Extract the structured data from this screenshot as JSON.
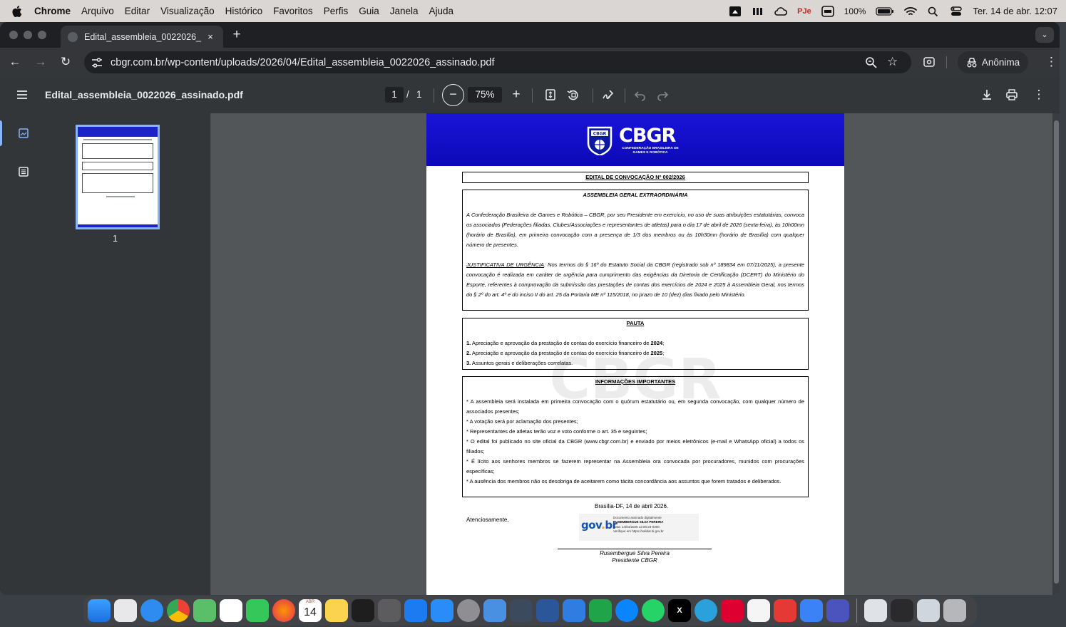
{
  "menubar": {
    "app_name": "Chrome",
    "menus": [
      "Arquivo",
      "Editar",
      "Visualização",
      "Histórico",
      "Favoritos",
      "Perfis",
      "Guia",
      "Janela",
      "Ajuda"
    ],
    "pje_label": "PJe",
    "battery": "100%",
    "clock": "Ter. 14 de abr.  12:07"
  },
  "browser": {
    "tab_title": "Edital_assembleia_0022026_",
    "tab_close": "×",
    "new_tab": "+",
    "url": "cbgr.com.br/wp-content/uploads/2026/04/Edital_assembleia_0022026_assinado.pdf",
    "incognito_label": "Anônima"
  },
  "pdf": {
    "file_name": "Edital_assembleia_0022026_assinado.pdf",
    "current_page": "1",
    "page_separator": "/",
    "total_pages": "1",
    "zoom": "75%",
    "thumbnail_label": "1"
  },
  "document": {
    "logo_text": "CBGR",
    "logo_subtitle": "CONFEDERAÇÃO BRASILEIRA DE GAMES E ROBÓTICA",
    "edital_title": "EDITAL DE CONVOCAÇÃO Nº 002/2026",
    "assembly_title": "ASSEMBLEIA GERAL EXTRAORDINÁRIA",
    "convocation_paragraph": "A Confederação Brasileira de Games e Robótica – CBGR, por seu Presidente em exercício, no uso de suas atribuições estatutárias, convoca os associados (Federações filiadas, Clubes/Associações e representantes de atletas) para o dia 17 de abril de 2026 (sexta-feira), às 10h00mn (horário de Brasília), em primeira convocação com a presença de 1/3 dos membros ou às 10h30mn (horário de Brasília) com qualquer número de presentes.",
    "urgency_label": "JUSTIFICATIVA DE URGÊNCIA",
    "urgency_text": ": Nos termos do § 16º do Estatuto Social da CBGR (registrado sob nº 189834 em 07/11/2025), a presente convocação é realizada em caráter de urgência para cumprimento das exigências da Diretoria de Certificação (DCERT) do Ministério do Esporte, referentes à comprovação da submissão das prestações de contas dos exercícios de 2024 e 2025 à Assembleia Geral, nos termos do § 2º do art. 4º e do inciso II do art. 25 da Portaria ME nº 115/2018, no prazo de 10 (dez) dias fixado pelo Ministério.",
    "pauta_title": "PAUTA",
    "pauta_items": [
      {
        "num": "1.",
        "text": " Apreciação e aprovação da prestação de contas do exercício financeiro de ",
        "bold": "2024",
        "end": ";"
      },
      {
        "num": "2.",
        "text": " Apreciação e aprovação da prestação de contas do exercício financeiro de ",
        "bold": "2025",
        "end": ";"
      },
      {
        "num": "3.",
        "text": " Assuntos gerais e deliberações correlatas.",
        "bold": "",
        "end": ""
      }
    ],
    "info_title": "INFORMAÇÕES IMPORTANTES",
    "info_items": [
      "* A assembleia será instalada em primeira convocação com o quórum estatutário ou, em segunda convocação, com qualquer número de associados presentes;",
      "*  A votação será por aclamação dos presentes;",
      "*  Representantes de atletas terão voz e voto conforme o art. 35 e seguintes;",
      "*  O edital foi publicado no site oficial da CBGR (www.cbgr.com.br) e enviado por meios eletrônicos (e-mail e WhatsApp oficial) a todos os filiados;",
      "*  É lícito aos senhores membros se fazerem representar na Assembleia ora convocada por procuradores, munidos com procurações específicas;",
      "*  A ausência dos membros não os desobriga de aceitarem como tácita concordância aos assuntos que forem tratados e deliberados."
    ],
    "date_line": "Brasília-DF, 14 de abril 2026.",
    "closing": "Atenciosamente,",
    "govbr": {
      "logo": "gov.br",
      "line1": "Documento assinado digitalmente",
      "line2": "RUSEMBERGUE SILVA PEREIRA",
      "line3": "Data: 14/04/2026 12:00:23-0300",
      "line4": "Verifique em https://validar.iti.gov.br"
    },
    "signer_name": "Rusembergue Silva Pereira",
    "signer_role": "Presidente CBGR"
  },
  "dock": {
    "calendar_month": "ABR",
    "calendar_day": "14",
    "apps": [
      "finder-icon",
      "launchpad-icon",
      "safari-icon",
      "chrome-icon",
      "maps-icon",
      "photos-icon",
      "facetime-icon",
      "firefox-icon",
      "calendar-icon",
      "notes-icon",
      "stocks-icon",
      "calculator-icon",
      "keynote-icon",
      "app-store-icon",
      "system-settings-icon",
      "preview-icon",
      "migration-icon",
      "word-icon",
      "cloud-icon",
      "vpn-icon",
      "messenger-icon",
      "whatsapp-icon",
      "x-icon",
      "telegram-icon",
      "angular-icon",
      "pje-icon",
      "pdf-icon",
      "drive-icon",
      "teams-icon"
    ]
  },
  "colors": {
    "accent": "#8ab4f8",
    "doc_header": "#1a14d8",
    "chrome_toolbar": "#35363a",
    "pdf_bar": "#323639"
  }
}
